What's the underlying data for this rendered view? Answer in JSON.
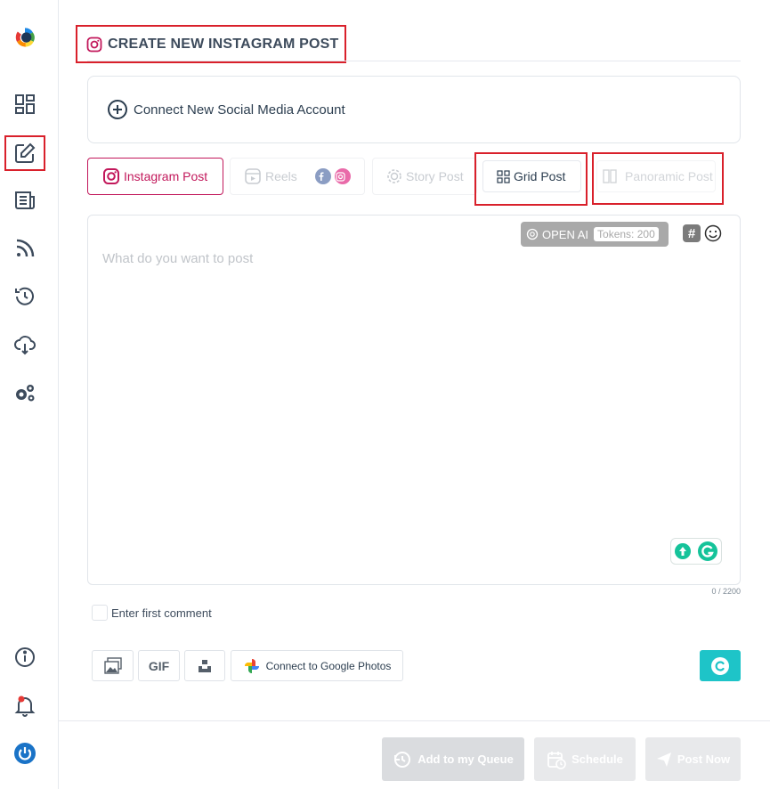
{
  "header": {
    "title": "CREATE NEW INSTAGRAM POST"
  },
  "connect": {
    "label": "Connect New Social Media Account"
  },
  "tabs": {
    "instagram_post": "Instagram Post",
    "reels": "Reels",
    "story_post": "Story Post",
    "grid_post": "Grid Post",
    "panoramic_post": "Panoramic Post"
  },
  "editor": {
    "placeholder": "What do you want to post",
    "openai_label": "OPEN AI",
    "tokens_label": "Tokens: 200",
    "hashtag_symbol": "#",
    "char_count": "0 / 2200"
  },
  "first_comment": {
    "label": "Enter first comment"
  },
  "media": {
    "gif_label": "GIF",
    "google_photos_label": "Connect to Google Photos"
  },
  "footer": {
    "add_queue": "Add to my Queue",
    "schedule": "Schedule",
    "post_now": "Post Now"
  },
  "colors": {
    "accent_pink": "#c2185b",
    "highlight_red": "#d9202b",
    "canva_teal": "#1ec4c8",
    "power_blue": "#1a73c7"
  },
  "icons": {
    "sidebar": [
      "logo-icon",
      "dashboard-icon",
      "compose-icon",
      "feed-icon",
      "rss-icon",
      "history-icon",
      "cloud-download-icon",
      "settings-icon",
      "info-icon",
      "notification-bell-icon",
      "power-icon"
    ]
  }
}
